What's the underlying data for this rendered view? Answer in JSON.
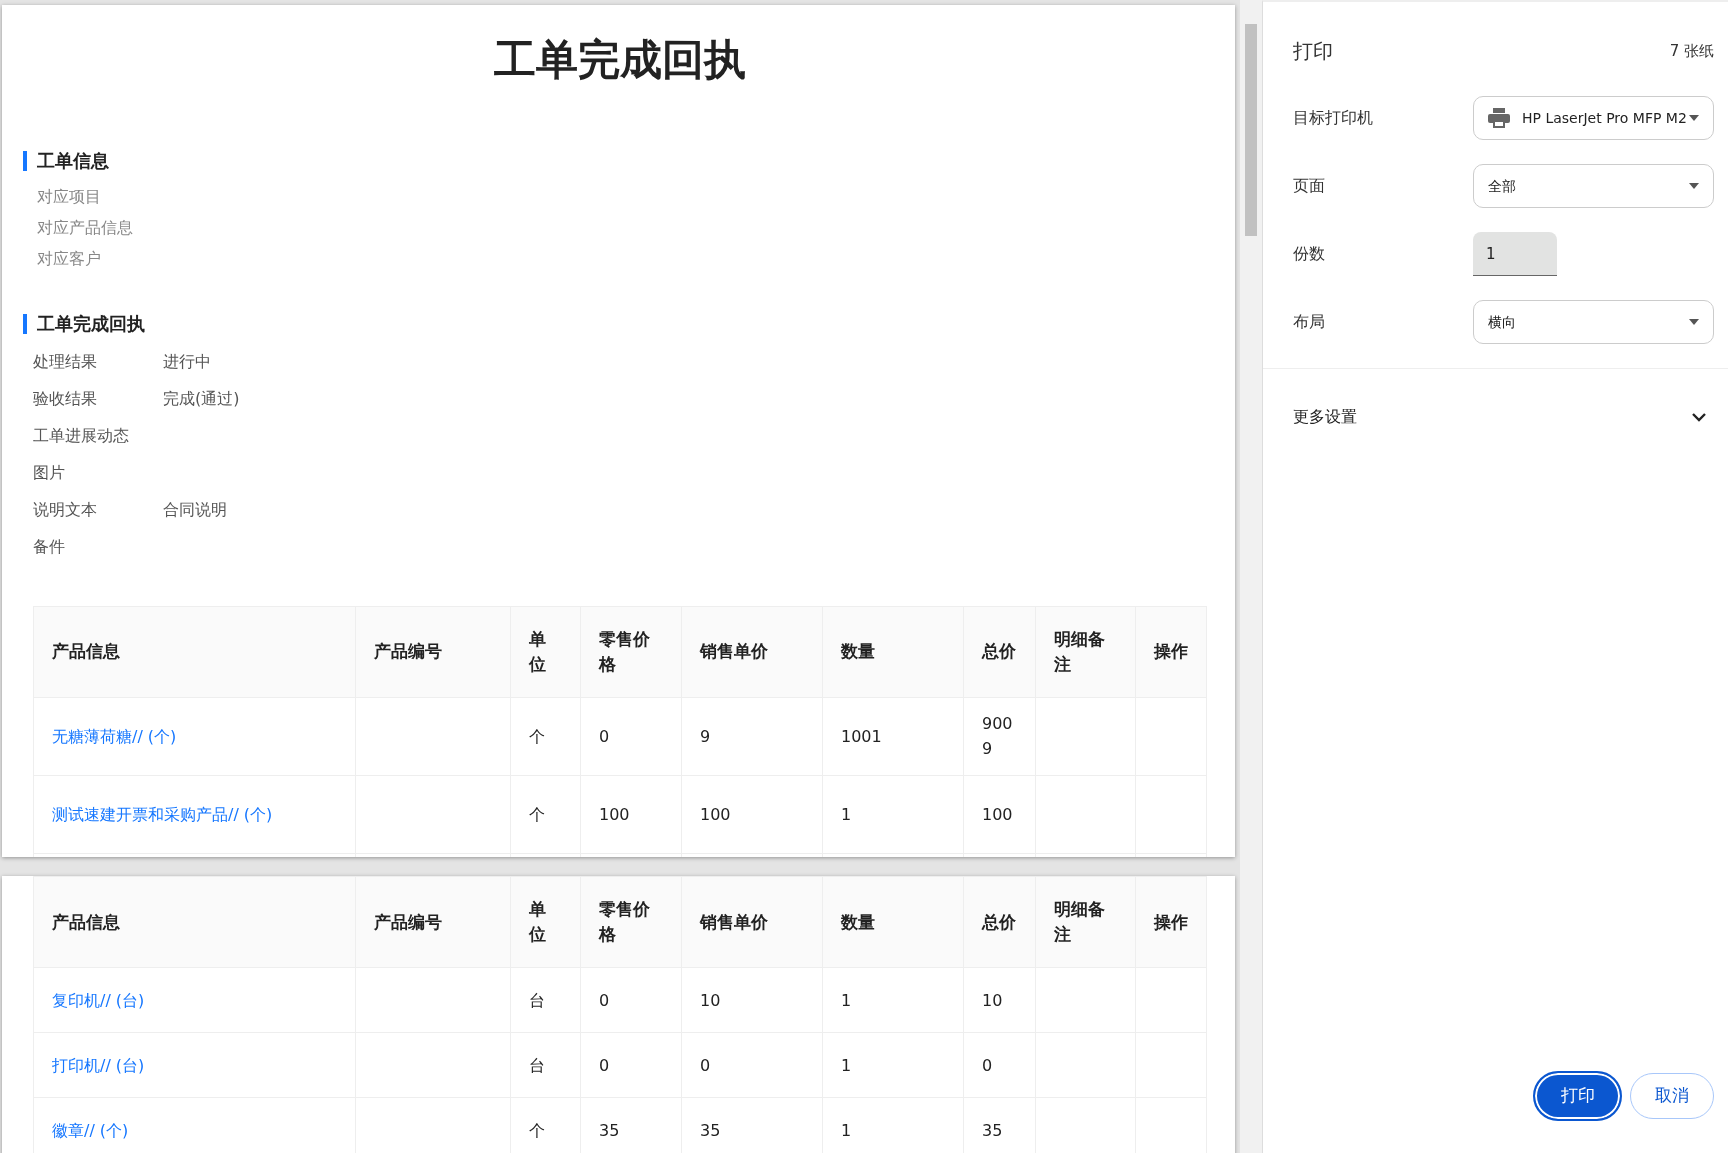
{
  "preview": {
    "pages": [
      {
        "title": "工单完成回执",
        "sections": [
          {
            "heading": "工单信息",
            "kind": "plain",
            "items": [
              {
                "label": "对应项目"
              },
              {
                "label": "对应产品信息"
              },
              {
                "label": "对应客户"
              }
            ]
          },
          {
            "heading": "工单完成回执",
            "kind": "pairs",
            "items": [
              {
                "label": "处理结果",
                "value": "进行中"
              },
              {
                "label": "验收结果",
                "value": "完成(通过)"
              },
              {
                "label": "工单进展动态"
              },
              {
                "label": "图片"
              },
              {
                "label": "说明文本",
                "value": "合同说明"
              },
              {
                "label": "备件"
              }
            ]
          }
        ],
        "table": {
          "columns": [
            "产品信息",
            "产品编号",
            "单位",
            "零售价格",
            "销售单价",
            "数量",
            "总价",
            "明细备注",
            "操作"
          ],
          "rows": [
            {
              "product": "无糖薄荷糖// (个)",
              "unit": "个",
              "retail": "0",
              "price": "9",
              "qty": "1001",
              "total": "9009"
            },
            {
              "product": "测试速建开票和采购产品// (个)",
              "unit": "个",
              "retail": "100",
              "price": "100",
              "qty": "1",
              "total": "100"
            }
          ]
        }
      },
      {
        "table": {
          "columns": [
            "产品信息",
            "产品编号",
            "单位",
            "零售价格",
            "销售单价",
            "数量",
            "总价",
            "明细备注",
            "操作"
          ],
          "rows": [
            {
              "product": "复印机// (台)",
              "unit": "台",
              "retail": "0",
              "price": "10",
              "qty": "1",
              "total": "10"
            },
            {
              "product": "打印机// (台)",
              "unit": "台",
              "retail": "0",
              "price": "0",
              "qty": "1",
              "total": "0"
            },
            {
              "product": "徽章// (个)",
              "unit": "个",
              "retail": "35",
              "price": "35",
              "qty": "1",
              "total": "35"
            }
          ]
        }
      }
    ]
  },
  "print_panel": {
    "title": "打印",
    "sheets": "7 张纸",
    "settings": [
      {
        "label": "目标打印机",
        "kind": "printer",
        "value": "HP LaserJet Pro MFP M2"
      },
      {
        "label": "页面",
        "kind": "select",
        "value": "全部"
      },
      {
        "label": "份数",
        "kind": "number",
        "value": "1"
      },
      {
        "label": "布局",
        "kind": "select",
        "value": "横向"
      }
    ],
    "more_settings": {
      "label": "更多设置",
      "expanded": false
    },
    "buttons": [
      {
        "label": "打印",
        "kind": "primary"
      },
      {
        "label": "取消",
        "kind": "secondary"
      }
    ]
  }
}
